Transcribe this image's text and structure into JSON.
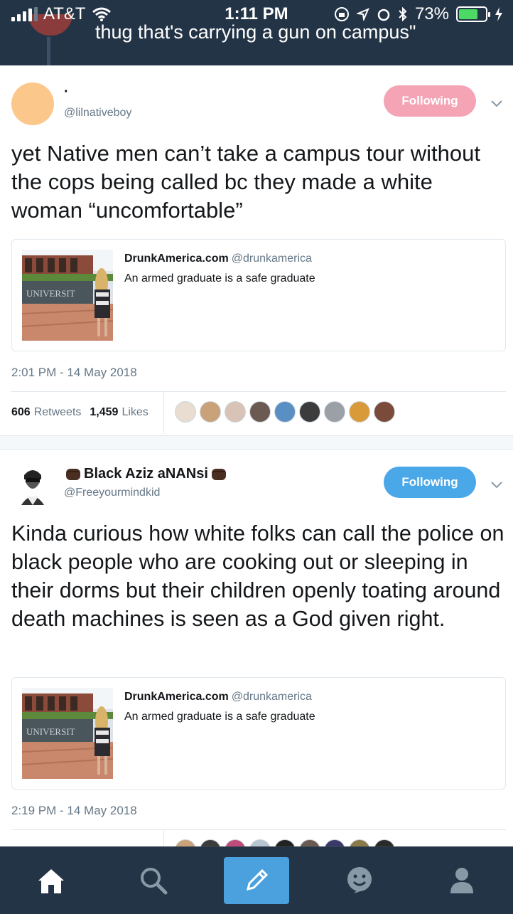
{
  "status_bar": {
    "carrier": "AT&T",
    "time": "1:11 PM",
    "battery_percent": "73%",
    "battery_level": 0.73
  },
  "peek": {
    "text": "thug that's carrying a gun on campus\""
  },
  "tweets": [
    {
      "display_name": "·",
      "handle": "@lilnativeboy",
      "follow_label": "Following",
      "text": "yet Native men can’t take a campus tour without the cops being called bc they made a white woman “uncomfortable”",
      "quote": {
        "name": "DrunkAmerica.com",
        "handle": "@drunkamerica",
        "text": "An armed graduate is a safe graduate",
        "image_sign": "UNIVERSIT"
      },
      "timestamp": "2:01 PM - 14 May 2018",
      "retweets_count": "606",
      "retweets_label": "Retweets",
      "likes_count": "1,459",
      "likes_label": "Likes"
    },
    {
      "display_name": "Black Aziz aNANsi",
      "handle": "@Freeyourmindkid",
      "follow_label": "Following",
      "text": "Kinda curious how white folks can call the police on black people who are cooking out or sleeping in their dorms but their children openly toating around death machines is seen as a God given right.",
      "quote": {
        "name": "DrunkAmerica.com",
        "handle": "@drunkamerica",
        "text": "An armed graduate is a safe graduate",
        "image_sign": "UNIVERSIT"
      },
      "timestamp": "2:19 PM - 14 May 2018"
    }
  ],
  "tabs": [
    {
      "icon": "home-icon"
    },
    {
      "icon": "search-icon"
    },
    {
      "icon": "compose-icon"
    },
    {
      "icon": "notifications-icon"
    },
    {
      "icon": "profile-icon"
    }
  ],
  "colors": {
    "dark_bar": "#243447",
    "following_pink": "#f5a4b5",
    "following_blue": "#4aa8e8",
    "compose_blue": "#4aa1de"
  }
}
